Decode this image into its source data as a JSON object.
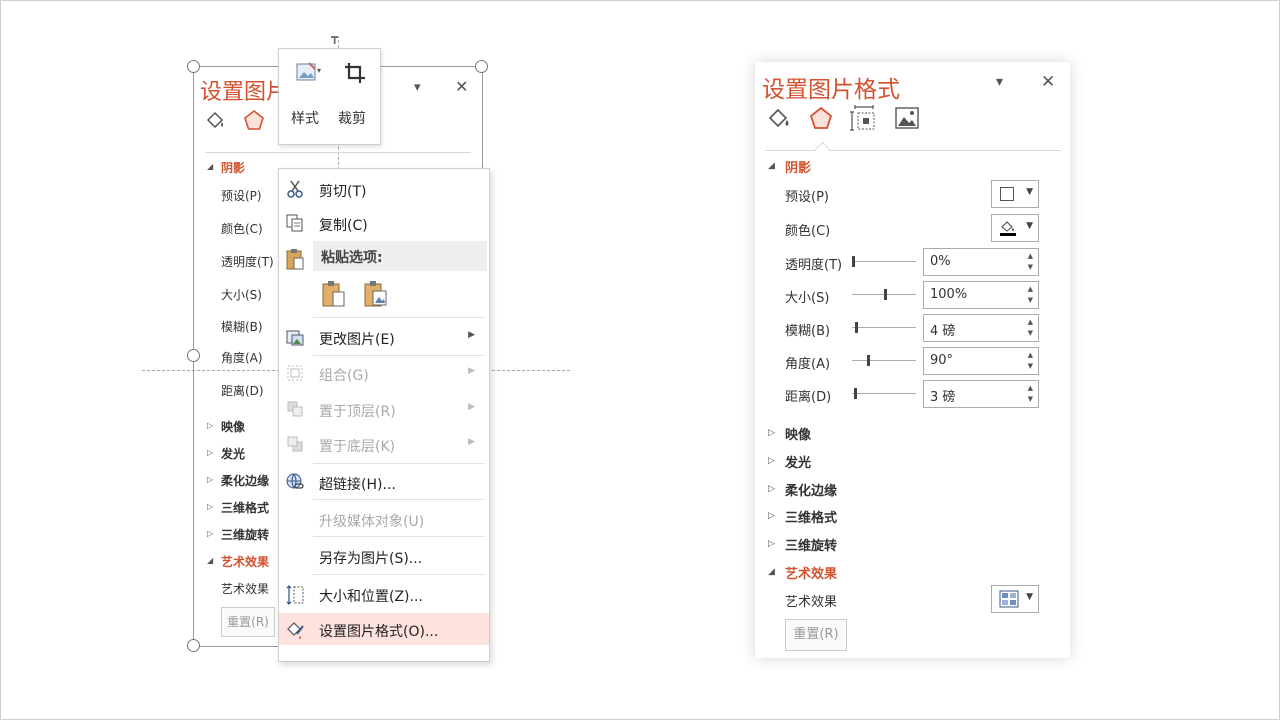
{
  "left": {
    "panel_title": "设置图片",
    "sections": {
      "shadow": "阴影",
      "reflection": "映像",
      "glow": "发光",
      "soft_edges": "柔化边缘",
      "format_3d": "三维格式",
      "rotation_3d": "三维旋转",
      "artistic": "艺术效果"
    },
    "props": {
      "preset": "预设(P)",
      "color": "颜色(C)",
      "transparency": "透明度(T)",
      "size": "大小(S)",
      "blur": "模糊(B)",
      "angle": "角度(A)",
      "distance": "距离(D)"
    },
    "artistic_effect_label": "艺术效果",
    "reset": "重置(R)",
    "mini_toolbar": {
      "style": "样式",
      "crop": "裁剪"
    },
    "context_menu": {
      "cut": "剪切(T)",
      "copy": "复制(C)",
      "paste_options": "粘贴选项:",
      "change_picture": "更改图片(E)",
      "group": "组合(G)",
      "bring_to_front": "置于顶层(R)",
      "send_to_back": "置于底层(K)",
      "hyperlink": "超链接(H)...",
      "upgrade_media": "升级媒体对象(U)",
      "save_as_picture": "另存为图片(S)...",
      "size_position": "大小和位置(Z)...",
      "format_picture": "设置图片格式(O)..."
    }
  },
  "right": {
    "title": "设置图片格式",
    "sections": {
      "shadow": "阴影",
      "reflection": "映像",
      "glow": "发光",
      "soft_edges": "柔化边缘",
      "format_3d": "三维格式",
      "rotation_3d": "三维旋转",
      "artistic": "艺术效果"
    },
    "props": {
      "preset": "预设(P)",
      "color": "颜色(C)",
      "transparency": "透明度(T)",
      "size": "大小(S)",
      "blur": "模糊(B)",
      "angle": "角度(A)",
      "distance": "距离(D)"
    },
    "values": {
      "transparency": "0%",
      "size": "100%",
      "blur": "4 磅",
      "angle": "90°",
      "distance": "3 磅"
    },
    "artistic_effect_label": "艺术效果",
    "reset": "重置(R)"
  },
  "colors": {
    "accent": "#d35230",
    "highlight": "#fde2de"
  }
}
